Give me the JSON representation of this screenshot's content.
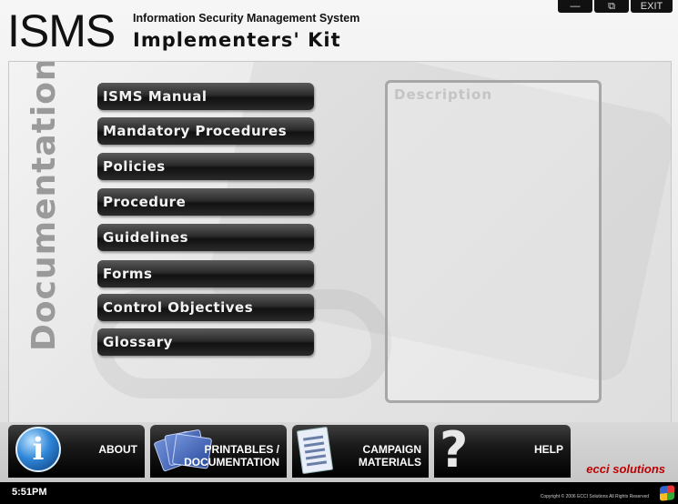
{
  "header": {
    "logo_big": "ISMS",
    "subtitle_line1": "Information Security Management System",
    "subtitle_line2": "Implementers' Kit"
  },
  "window_controls": {
    "minimize": "—",
    "restore": "⧉",
    "exit": "EXIT"
  },
  "sidebar": {
    "title": "Documentation"
  },
  "menu": {
    "items": [
      "ISMS Manual",
      "Mandatory Procedures",
      "Policies",
      "Procedure",
      "Guidelines",
      "Forms",
      "Control Objectives",
      "Glossary"
    ]
  },
  "description": {
    "title": "Description"
  },
  "bottom_nav": {
    "about": {
      "label": "ABOUT",
      "icon": "info-icon"
    },
    "printables": {
      "label_line1": "PRINTABLES /",
      "label_line2": "DOCUMENTATION",
      "icon": "books-icon"
    },
    "campaign": {
      "label_line1": "CAMPAIGN",
      "label_line2": "MATERIALS",
      "icon": "document-icon"
    },
    "help": {
      "label": "HELP",
      "icon": "question-icon"
    }
  },
  "status": {
    "time": "5:51PM",
    "brand": "ecci solutions",
    "copyright": "Copyright © 2006 ECCI Solutions All Rights Reserved"
  },
  "colors": {
    "button_dark": "#111111",
    "side_title": "#9a9a9a",
    "brand_red": "#c00000"
  }
}
